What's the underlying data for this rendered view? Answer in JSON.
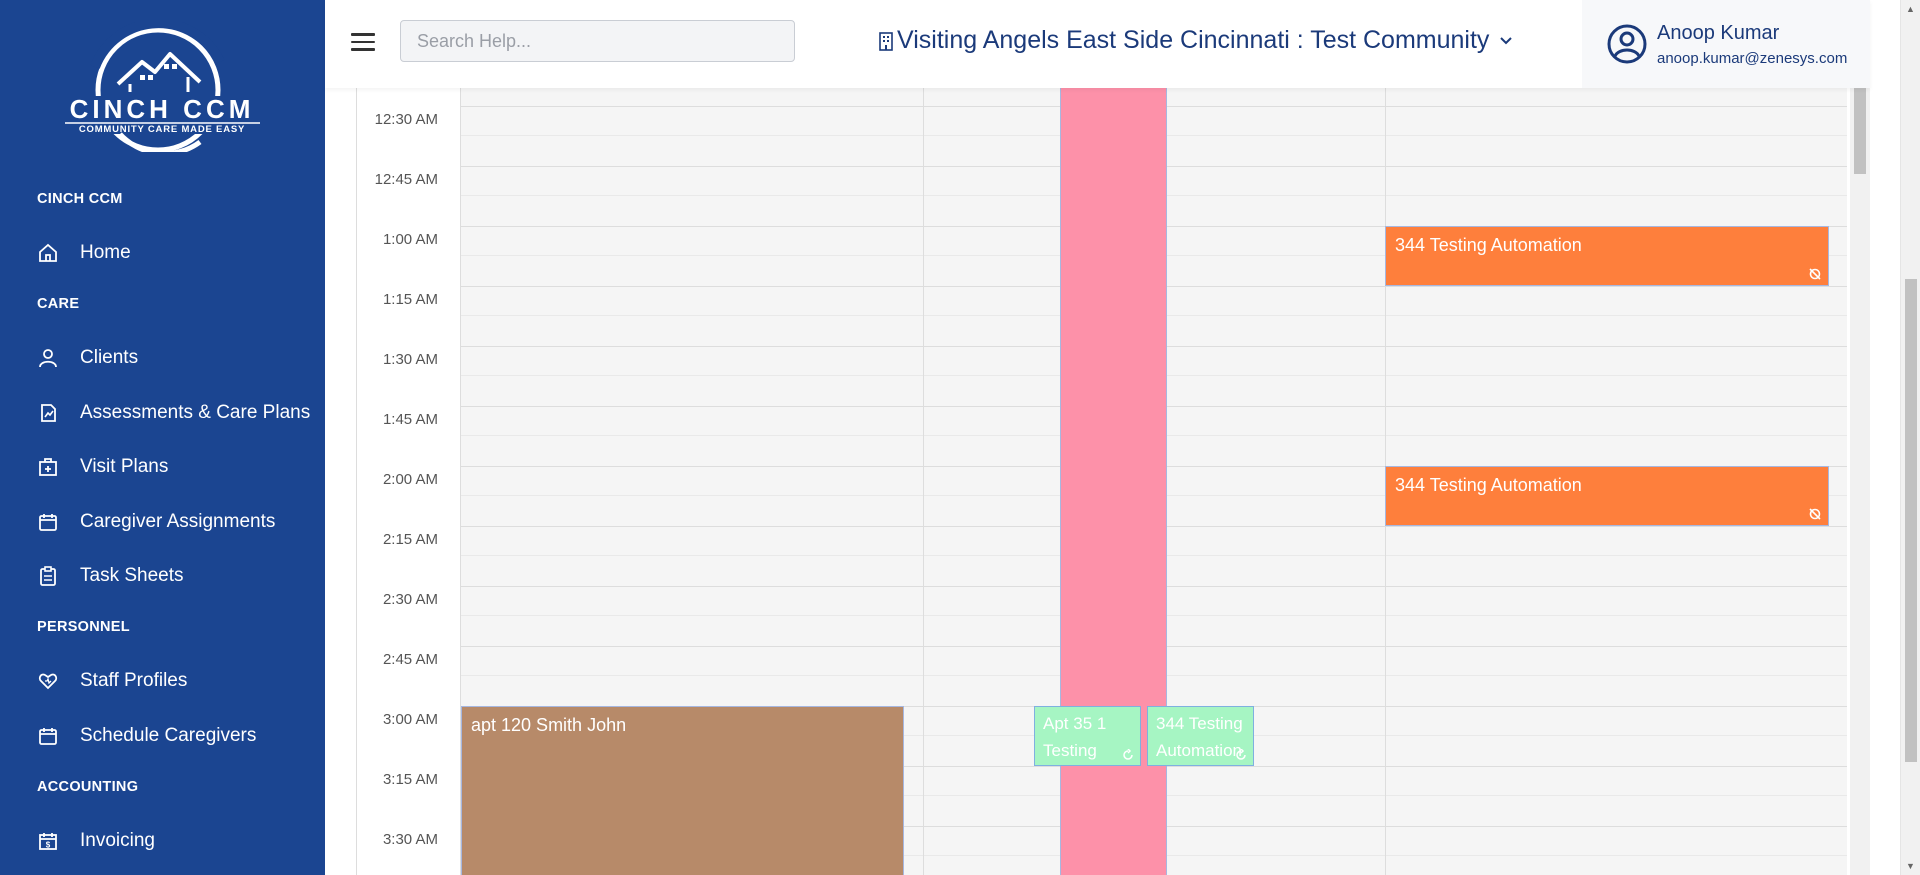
{
  "brand": {
    "name": "CINCH CCM",
    "tagline": "COMMUNITY CARE MADE EASY"
  },
  "sidebar": {
    "sections": [
      {
        "label": "CINCH CCM"
      },
      {
        "label": "CARE"
      },
      {
        "label": "PERSONNEL"
      },
      {
        "label": "ACCOUNTING"
      }
    ],
    "items": [
      {
        "label": "Home",
        "icon": "home-icon"
      },
      {
        "label": "Clients",
        "icon": "user-icon"
      },
      {
        "label": "Assessments & Care Plans",
        "icon": "document-chart-icon"
      },
      {
        "label": "Visit Plans",
        "icon": "medical-kit-icon"
      },
      {
        "label": "Caregiver Assignments",
        "icon": "calendar-icon"
      },
      {
        "label": "Task Sheets",
        "icon": "clipboard-icon"
      },
      {
        "label": "Staff Profiles",
        "icon": "heart-icon"
      },
      {
        "label": "Schedule Caregivers",
        "icon": "calendar-icon"
      },
      {
        "label": "Invoicing",
        "icon": "invoice-icon"
      }
    ]
  },
  "header": {
    "search_placeholder": "Search Help...",
    "community": "Visiting Angels East Side Cincinnati : Test Community",
    "user_name": "Anoop Kumar",
    "user_email": "anoop.kumar@zenesys.com"
  },
  "calendar": {
    "time_slots": [
      "12:30 AM",
      "12:45 AM",
      "1:00 AM",
      "1:15 AM",
      "1:30 AM",
      "1:45 AM",
      "2:00 AM",
      "2:15 AM",
      "2:30 AM",
      "2:45 AM",
      "3:00 AM",
      "3:15 AM",
      "3:30 AM"
    ],
    "events": [
      {
        "title": "344 Testing Automation",
        "start": "1:00 AM",
        "color": "#fe7f3c"
      },
      {
        "title": "344 Testing Automation",
        "start": "2:00 AM",
        "color": "#fe7f3c"
      },
      {
        "title": "apt 120 Smith John",
        "start": "3:00 AM",
        "color": "#b78a69"
      },
      {
        "title": "Apt 35 1 Testing",
        "start": "3:00 AM",
        "color": "#a6f5c3"
      },
      {
        "title": "344 Testing Automation",
        "start": "3:00 AM",
        "color": "#a6f5c3"
      }
    ],
    "highlight_color": "#fd91a9"
  },
  "colors": {
    "sidebar_bg": "#1b4591",
    "accent_text": "#1b3a7a"
  }
}
